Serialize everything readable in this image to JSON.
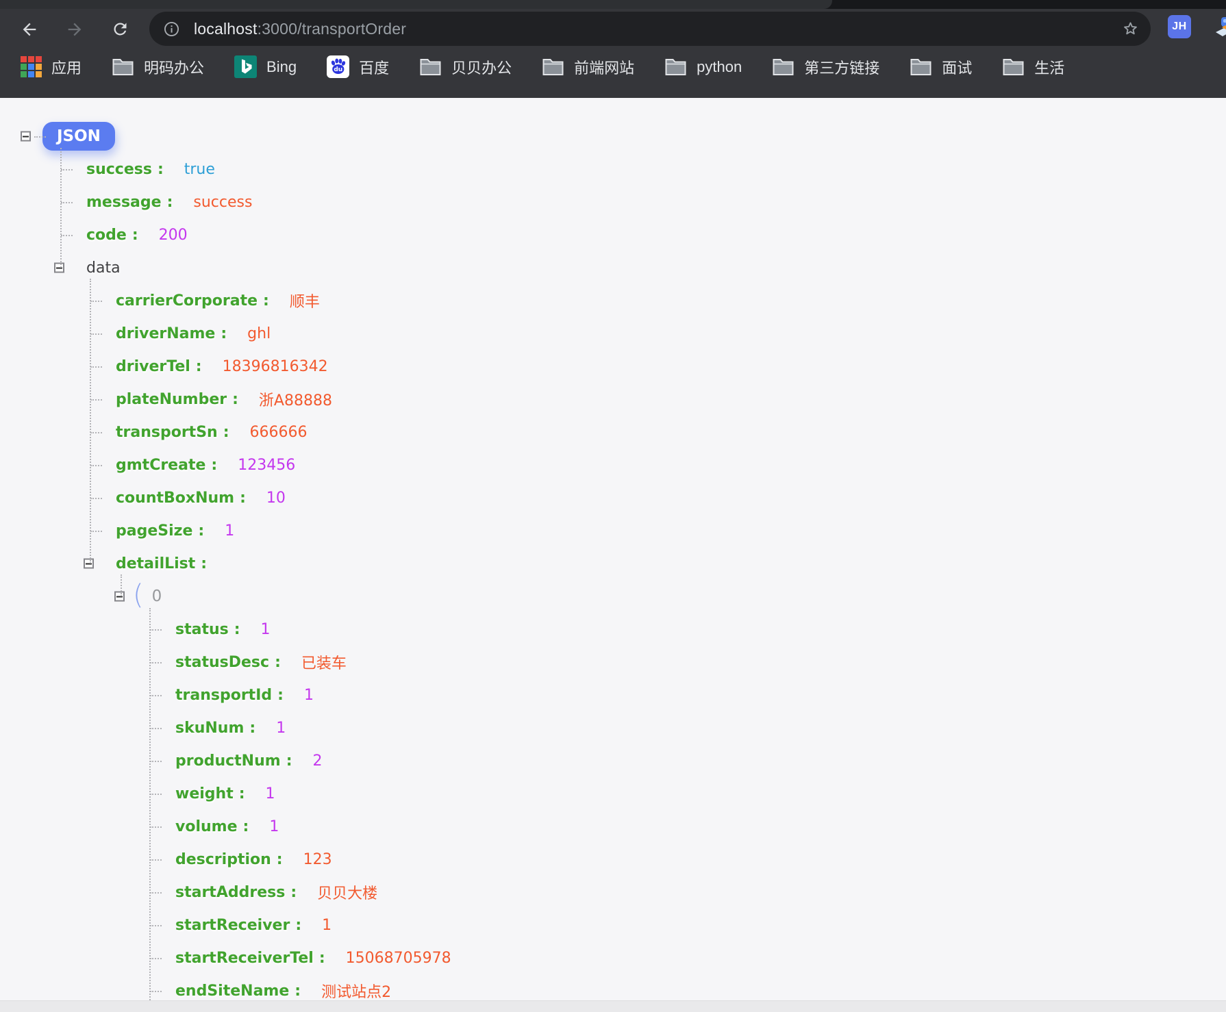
{
  "browser": {
    "url_host": "localhost",
    "url_rest": ":3000/transportOrder",
    "extension_badge": "JH",
    "bookmarks": [
      {
        "icon": "apps",
        "label": "应用"
      },
      {
        "icon": "folder",
        "label": "明码办公"
      },
      {
        "icon": "bing",
        "label": "Bing"
      },
      {
        "icon": "baidu",
        "label": "百度"
      },
      {
        "icon": "folder",
        "label": "贝贝办公"
      },
      {
        "icon": "folder",
        "label": "前端网站"
      },
      {
        "icon": "folder",
        "label": "python"
      },
      {
        "icon": "folder",
        "label": "第三方链接"
      },
      {
        "icon": "folder",
        "label": "面试"
      },
      {
        "icon": "folder",
        "label": "生活"
      }
    ]
  },
  "json_tree": {
    "root_label": "JSON",
    "rows": [
      {
        "level": 1,
        "key": "success",
        "value": "true",
        "vtype": "bool"
      },
      {
        "level": 1,
        "key": "message",
        "value": "success",
        "vtype": "string"
      },
      {
        "level": 1,
        "key": "code",
        "value": "200",
        "vtype": "number"
      },
      {
        "level": 1,
        "key": "data",
        "plain": true,
        "expand": true,
        "colon": false
      },
      {
        "level": 2,
        "key": "carrierCorporate",
        "value": "顺丰",
        "vtype": "string"
      },
      {
        "level": 2,
        "key": "driverName",
        "value": "ghl",
        "vtype": "string"
      },
      {
        "level": 2,
        "key": "driverTel",
        "value": "18396816342",
        "vtype": "string"
      },
      {
        "level": 2,
        "key": "plateNumber",
        "value": "浙A88888",
        "vtype": "string"
      },
      {
        "level": 2,
        "key": "transportSn",
        "value": "666666",
        "vtype": "string"
      },
      {
        "level": 2,
        "key": "gmtCreate",
        "value": "123456",
        "vtype": "number"
      },
      {
        "level": 2,
        "key": "countBoxNum",
        "value": "10",
        "vtype": "number"
      },
      {
        "level": 2,
        "key": "pageSize",
        "value": "1",
        "vtype": "number"
      },
      {
        "level": 2,
        "key": "detailList",
        "expand": true,
        "colon": true
      },
      {
        "level": 3,
        "kind": "index",
        "index": "0",
        "paren": "(",
        "expand": true
      },
      {
        "level": 4,
        "key": "status",
        "value": "1",
        "vtype": "number"
      },
      {
        "level": 4,
        "key": "statusDesc",
        "value": "已装车",
        "vtype": "string"
      },
      {
        "level": 4,
        "key": "transportId",
        "value": "1",
        "vtype": "number"
      },
      {
        "level": 4,
        "key": "skuNum",
        "value": "1",
        "vtype": "number"
      },
      {
        "level": 4,
        "key": "productNum",
        "value": "2",
        "vtype": "number"
      },
      {
        "level": 4,
        "key": "weight",
        "value": "1",
        "vtype": "number"
      },
      {
        "level": 4,
        "key": "volume",
        "value": "1",
        "vtype": "number"
      },
      {
        "level": 4,
        "key": "description",
        "value": "123",
        "vtype": "string"
      },
      {
        "level": 4,
        "key": "startAddress",
        "value": "贝贝大楼",
        "vtype": "string"
      },
      {
        "level": 4,
        "key": "startReceiver",
        "value": "1",
        "vtype": "string"
      },
      {
        "level": 4,
        "key": "startReceiverTel",
        "value": "15068705978",
        "vtype": "string"
      },
      {
        "level": 4,
        "key": "endSiteName",
        "value": "测试站点2",
        "vtype": "string"
      }
    ]
  },
  "colors": {
    "key_green": "#41a32e",
    "string_orange": "#f25a2f",
    "number_magenta": "#c437ee",
    "boolean_blue": "#2d9fd6",
    "plain_key": "#3f3f42",
    "index_gray": "#97999c",
    "root_pill_blue": "#5b7cf0"
  }
}
